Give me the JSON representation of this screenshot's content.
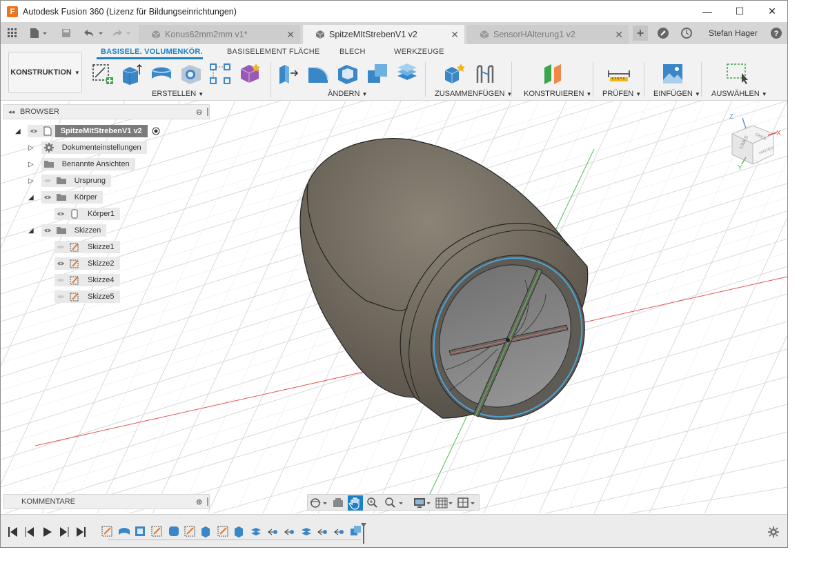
{
  "window": {
    "title": "Autodesk Fusion 360 (Lizenz für Bildungseinrichtungen)",
    "app_icon_letter": "F",
    "minimize": "—",
    "maximize": "☐",
    "close": "✕"
  },
  "tabs": [
    {
      "label": "Konus62mm2mm v1*",
      "active": false
    },
    {
      "label": "SpitzeMItStrebenV1 v2",
      "active": true
    },
    {
      "label": "SensorHAlterung1 v2",
      "active": false
    }
  ],
  "tab_close": "✕",
  "new_tab": "+",
  "user": {
    "name": "Stefan Hager"
  },
  "help": "?",
  "ribbon": {
    "workspace": "KONSTRUKTION",
    "tabs": [
      "BASISELE. VOLUMENKÖR.",
      "BASISELEMENT FLÄCHE",
      "BLECH",
      "WERKZEUGE"
    ],
    "groups": [
      "ERSTELLEN",
      "ÄNDERN",
      "ZUSAMMENFÜGEN",
      "KONSTRUIEREN",
      "PRÜFEN",
      "EINFÜGEN",
      "AUSWÄHLEN"
    ],
    "accent": "#1b80c4"
  },
  "browser": {
    "title": "BROWSER",
    "root": "SpitzeMItStrebenV1 v2",
    "items": [
      {
        "label": "Dokumenteinstellungen",
        "type": "settings"
      },
      {
        "label": "Benannte Ansichten",
        "type": "folder"
      },
      {
        "label": "Ursprung",
        "type": "folder"
      },
      {
        "label": "Körper",
        "type": "folder"
      },
      {
        "label": "Körper1",
        "type": "body"
      },
      {
        "label": "Skizzen",
        "type": "folder"
      },
      {
        "label": "Skizze1",
        "type": "sketch"
      },
      {
        "label": "Skizze2",
        "type": "sketch"
      },
      {
        "label": "Skizze4",
        "type": "sketch"
      },
      {
        "label": "Skizze5",
        "type": "sketch"
      }
    ]
  },
  "viewcube": {
    "face_label": "LINKS",
    "face_top": "OBEN",
    "face_right": "HINTEN",
    "axes": [
      "Z",
      "X",
      "Y"
    ]
  },
  "comments": {
    "title": "KOMMENTARE"
  },
  "colors": {
    "body": "#6f685d",
    "x_axis": "#e05555",
    "y_axis": "#4fc04f",
    "selection": "#4aa3d6"
  }
}
